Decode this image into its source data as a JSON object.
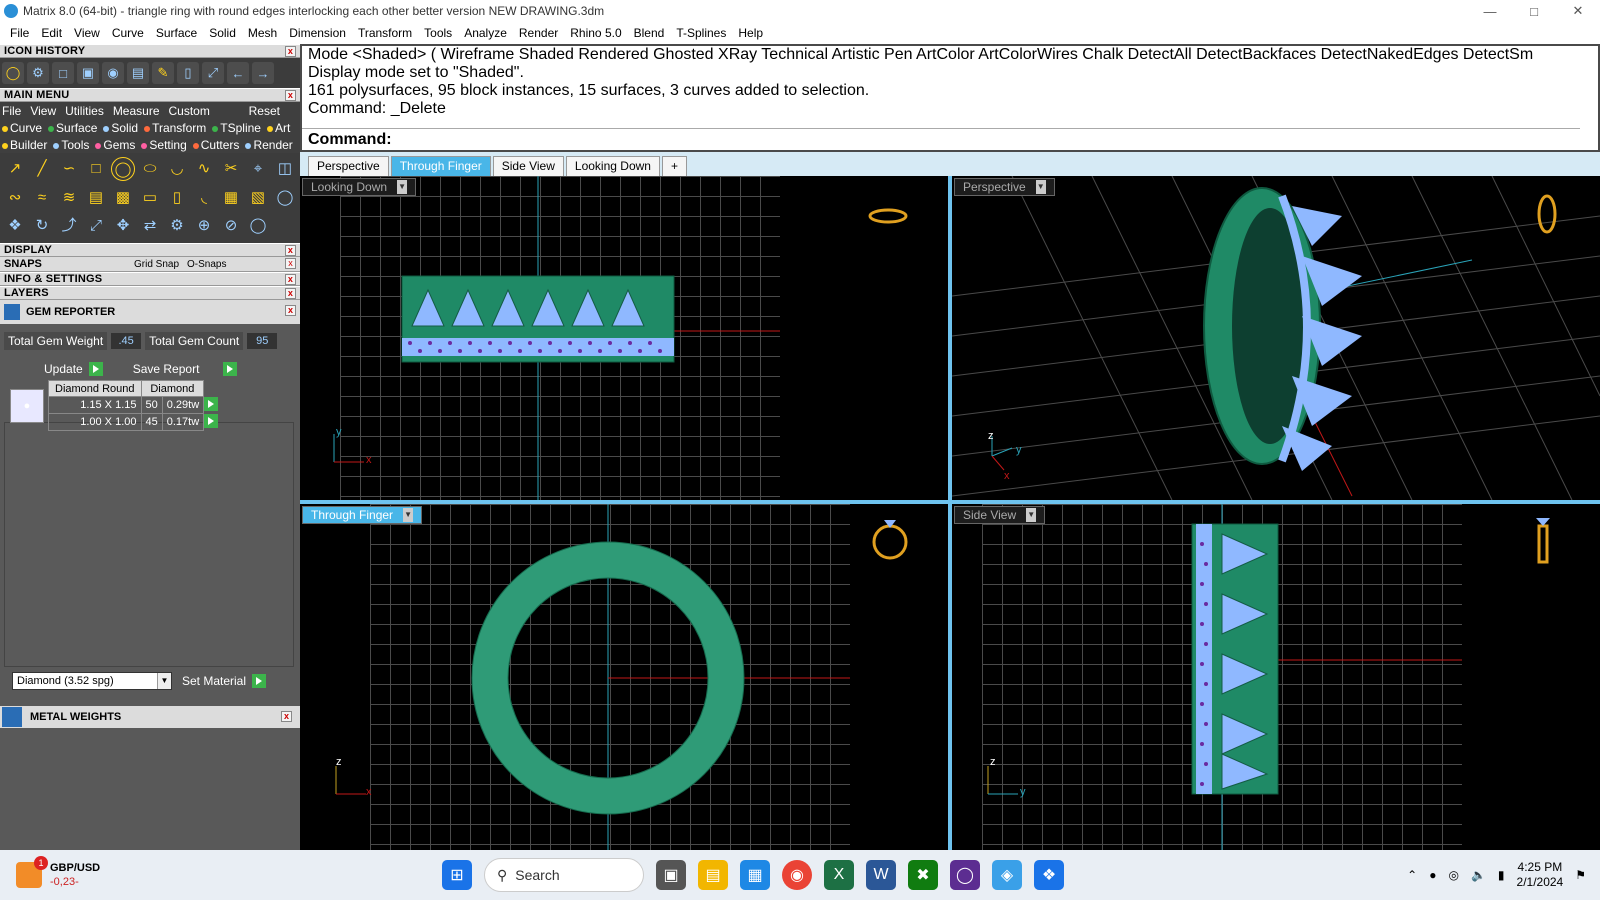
{
  "window": {
    "title": "Matrix 8.0 (64-bit) - triangle ring with round edges interlocking each other better version NEW DRAWING.3dm"
  },
  "menu": [
    "File",
    "Edit",
    "View",
    "Curve",
    "Surface",
    "Solid",
    "Mesh",
    "Dimension",
    "Transform",
    "Tools",
    "Analyze",
    "Render",
    "Rhino 5.0",
    "Blend",
    "T-Splines",
    "Help"
  ],
  "panels": {
    "icon_history": "ICON HISTORY",
    "main_menu": "MAIN MENU",
    "main_menu_items": [
      "File",
      "View",
      "Utilities",
      "Measure",
      "Custom"
    ],
    "reset": "Reset",
    "categories_row1": [
      {
        "label": "Curve",
        "color": "#ffd21e"
      },
      {
        "label": "Surface",
        "color": "#3cb44b"
      },
      {
        "label": "Solid",
        "color": "#9fd0ff"
      },
      {
        "label": "Transform",
        "color": "#ff6a3d"
      },
      {
        "label": "TSpline",
        "color": "#3cb44b"
      },
      {
        "label": "Art",
        "color": "#ffd21e"
      }
    ],
    "categories_row2": [
      {
        "label": "Builder",
        "color": "#ffd21e"
      },
      {
        "label": "Tools",
        "color": "#9fd0ff"
      },
      {
        "label": "Gems",
        "color": "#ff5fa2"
      },
      {
        "label": "Setting",
        "color": "#ff5fa2"
      },
      {
        "label": "Cutters",
        "color": "#ff6a3d"
      },
      {
        "label": "Render",
        "color": "#9fd0ff"
      }
    ],
    "display": "DISPLAY",
    "snaps": "SNAPS",
    "grid_snap": "Grid Snap",
    "o_snaps": "O-Snaps",
    "info_settings": "INFO & SETTINGS",
    "layers": "LAYERS",
    "gem_reporter": "GEM REPORTER",
    "metal_weights": "METAL WEIGHTS"
  },
  "gem": {
    "total_weight_label": "Total Gem Weight",
    "total_weight": ".45",
    "total_count_label": "Total Gem Count",
    "total_count": "95",
    "update": "Update",
    "save_report": "Save Report",
    "table_header": [
      "Diamond Round",
      "Diamond"
    ],
    "rows": [
      {
        "size": "1.15 X 1.15",
        "count": "50",
        "weight": "0.29tw"
      },
      {
        "size": "1.00 X 1.00",
        "count": "45",
        "weight": "0.17tw"
      }
    ],
    "material": "Diamond    (3.52 spg)",
    "set_material": "Set Material"
  },
  "command": {
    "lines": [
      "Mode <Shaded> ( Wireframe  Shaded  Rendered  Ghosted  XRay  Technical  Artistic  Pen  ArtColor  ArtColorWires  Chalk  DetectAll  DetectBackfaces  DetectNakedEdges  DetectSm",
      "Display mode set to \"Shaded\".",
      "161 polysurfaces, 95 block instances, 15 surfaces, 3 curves added to selection.",
      "Command: _Delete"
    ],
    "prompt": "Command:"
  },
  "tabs": [
    "Perspective",
    "Through Finger",
    "Side View",
    "Looking Down"
  ],
  "tab_add": "+",
  "viewports": {
    "top_left": "Looking Down",
    "top_right": "Perspective",
    "bottom_left": "Through Finger",
    "bottom_right": "Side View"
  },
  "axes": {
    "x": "x",
    "y": "y",
    "z": "z"
  },
  "taskbar": {
    "ticker": "GBP/USD",
    "ticker_change": "-0,23-",
    "ticker_badge": "1",
    "search": "Search",
    "time": "4:25 PM",
    "date": "2/1/2024"
  }
}
